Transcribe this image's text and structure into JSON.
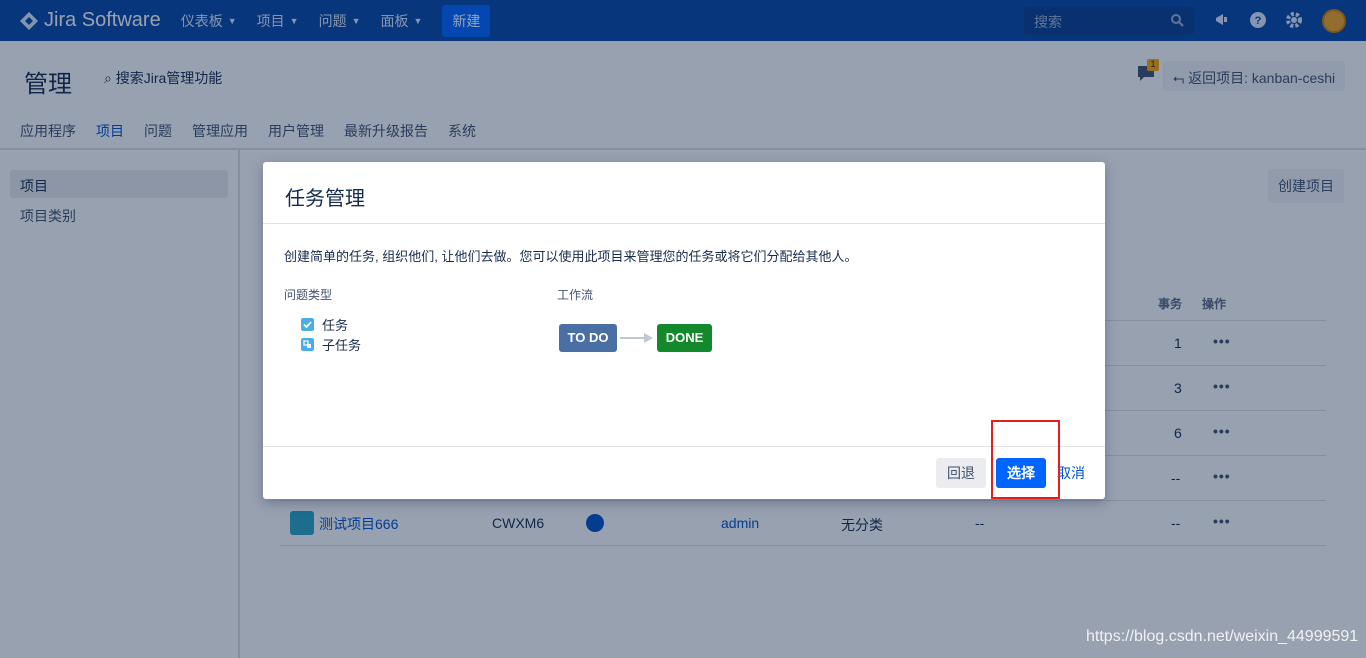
{
  "topnav": {
    "brand": "Jira Software",
    "items": [
      {
        "label": "仪表板"
      },
      {
        "label": "项目"
      },
      {
        "label": "问题"
      },
      {
        "label": "面板"
      }
    ],
    "create_label": "新建",
    "search_placeholder": "搜索",
    "icons": [
      "megaphone-icon",
      "help-icon",
      "settings-icon",
      "avatar"
    ]
  },
  "header": {
    "title": "管理",
    "admin_search": "搜索Jira管理功能",
    "notification_count": "1",
    "back_button": "返回项目: kanban-ceshi"
  },
  "tabs": [
    {
      "label": "应用程序",
      "active": false
    },
    {
      "label": "项目",
      "active": true
    },
    {
      "label": "问题",
      "active": false
    },
    {
      "label": "管理应用",
      "active": false
    },
    {
      "label": "用户管理",
      "active": false
    },
    {
      "label": "最新升级报告",
      "active": false
    },
    {
      "label": "系统",
      "active": false
    }
  ],
  "sidebar": {
    "items": [
      {
        "label": "项目",
        "active": true
      },
      {
        "label": "项目类别",
        "active": false
      }
    ]
  },
  "main": {
    "create_project_label": "创建项目",
    "table": {
      "headers": {
        "issues": "事务",
        "actions": "操作"
      },
      "rows": [
        {
          "issues": "1"
        },
        {
          "issues": "3"
        },
        {
          "issues": "6"
        },
        {
          "issues": "--"
        },
        {
          "name": "测试项目666",
          "key": "CWXM6",
          "lead": "admin",
          "category": "无分类",
          "url": "--",
          "issues": "--"
        }
      ]
    }
  },
  "dialog": {
    "title": "任务管理",
    "description": "创建简单的任务, 组织他们, 让他们去做。您可以使用此项目来管理您的任务或将它们分配给其他人。",
    "issue_types_label": "问题类型",
    "issue_types": [
      {
        "label": "任务",
        "icon": "task-icon"
      },
      {
        "label": "子任务",
        "icon": "subtask-icon"
      }
    ],
    "workflow_label": "工作流",
    "workflow": {
      "from": "TO DO",
      "to": "DONE"
    },
    "buttons": {
      "back": "回退",
      "select": "选择",
      "cancel": "取消"
    }
  },
  "watermark": "https://blog.csdn.net/weixin_44999591",
  "colors": {
    "nav": "#0747a6",
    "primary": "#0065ff",
    "done": "#14892c",
    "todo": "#4a6fa5",
    "highlight": "#e02020"
  }
}
